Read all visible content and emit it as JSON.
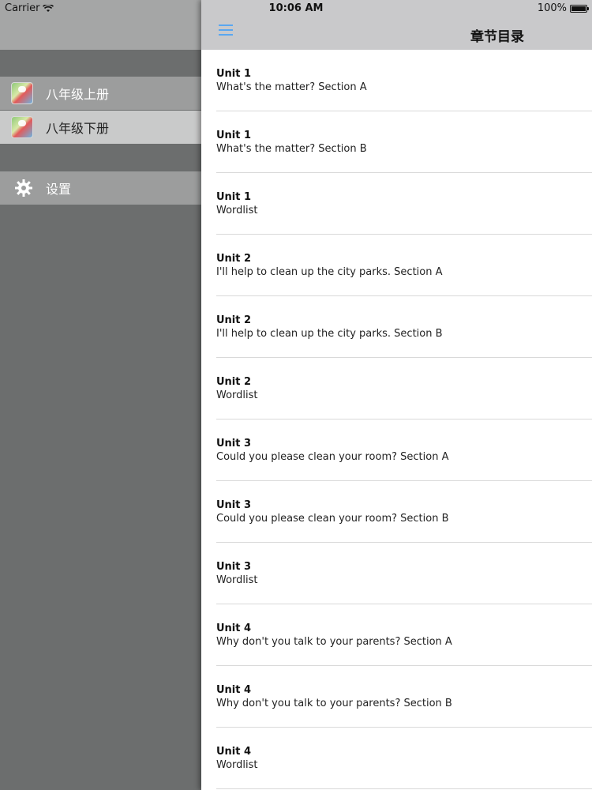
{
  "status_bar": {
    "carrier": "Carrier",
    "time": "10:06 AM",
    "battery": "100%"
  },
  "menu": {
    "items": [
      {
        "label": "八年级上册",
        "icon": "book-cover-icon",
        "selected": false
      },
      {
        "label": "八年级下册",
        "icon": "book-cover-icon",
        "selected": true
      },
      {
        "label": "设置",
        "icon": "gear-icon",
        "selected": false
      }
    ]
  },
  "navbar": {
    "title": "章节目录",
    "menu_icon": "hamburger-icon",
    "accent": "#5aa7f0"
  },
  "chapters": [
    {
      "unit": "Unit 1",
      "title": "What's the matter?   Section A"
    },
    {
      "unit": "Unit 1",
      "title": "What's the matter?   Section B"
    },
    {
      "unit": "Unit 1",
      "title": "Wordlist"
    },
    {
      "unit": "Unit 2",
      "title": "I'll help to clean up the city parks. Section A"
    },
    {
      "unit": "Unit 2",
      "title": "I'll help to clean up the city parks. Section B"
    },
    {
      "unit": "Unit 2",
      "title": "Wordlist"
    },
    {
      "unit": "Unit 3",
      "title": "Could you please clean your room?   Section A"
    },
    {
      "unit": "Unit 3",
      "title": "Could you please clean your room?   Section B"
    },
    {
      "unit": "Unit 3",
      "title": "Wordlist"
    },
    {
      "unit": "Unit 4",
      "title": "Why don't you talk to your parents?   Section A"
    },
    {
      "unit": "Unit 4",
      "title": "Why don't you talk to your parents?   Section B"
    },
    {
      "unit": "Unit 4",
      "title": "Wordlist"
    }
  ]
}
